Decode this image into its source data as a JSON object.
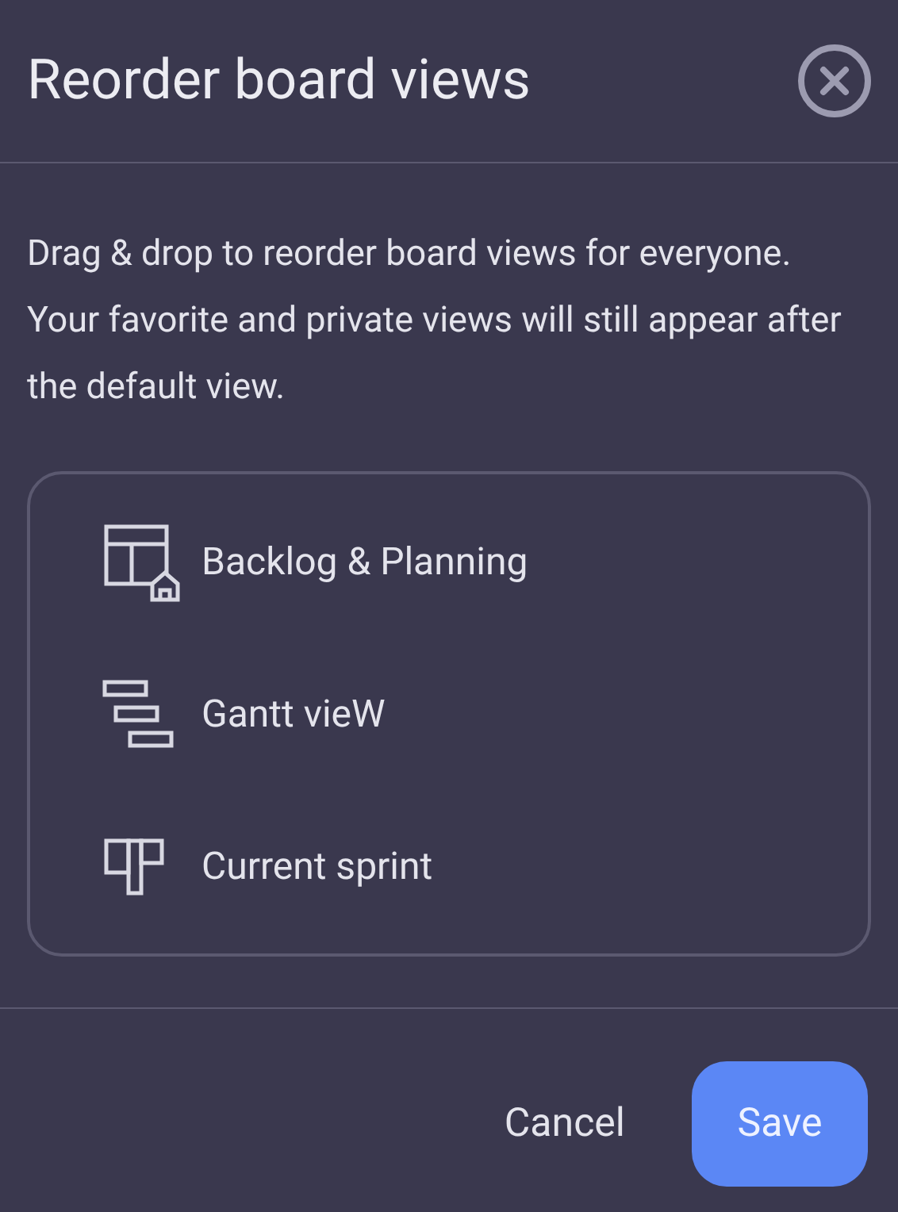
{
  "dialog": {
    "title": "Reorder board views",
    "description": "Drag & drop to reorder board views for everyone. Your favorite and private views will still appear after the default view."
  },
  "views": [
    {
      "kind": "table",
      "label": "Backlog & Planning"
    },
    {
      "kind": "gantt",
      "label": "Gantt vieW"
    },
    {
      "kind": "kanban",
      "label": "Current sprint"
    }
  ],
  "buttons": {
    "cancel": "Cancel",
    "save": "Save"
  }
}
